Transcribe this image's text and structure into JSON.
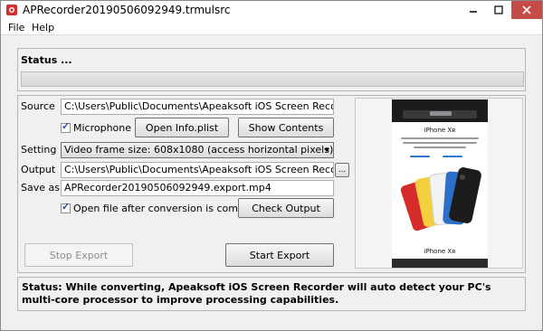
{
  "window": {
    "title": "APRecorder20190506092949.trmulsrc"
  },
  "menu": {
    "items": [
      {
        "label": "File"
      },
      {
        "label": "Help"
      }
    ]
  },
  "status_group": {
    "label": "Status ...",
    "progress": 0
  },
  "form": {
    "source_label": "Source",
    "source_value": "C:\\Users\\Public\\Documents\\Apeaksoft iOS Screen Recorder\\Projec",
    "microphone_label": "Microphone",
    "microphone_checked": true,
    "open_info_label": "Open Info.plist",
    "show_contents_label": "Show Contents",
    "setting_label": "Setting",
    "setting_value": "Video frame size: 608x1080 (access horizontal pixels)",
    "output_label": "Output",
    "output_value": "C:\\Users\\Public\\Documents\\Apeaksoft iOS Screen Recorder\\Projec",
    "browse_label": "...",
    "save_as_label": "Save as",
    "save_as_value": "APRecorder20190506092949.export.mp4",
    "open_after_label": "Open file after conversion is complete",
    "open_after_checked": true,
    "check_output_label": "Check Output",
    "stop_export_label": "Stop Export",
    "start_export_label": "Start Export"
  },
  "preview": {
    "heading_top": "iPhone Xʀ",
    "heading_bottom": "iPhone Xʀ"
  },
  "status_bottom": {
    "text": "Status: While converting, Apeaksoft iOS Screen Recorder will auto detect your PC's multi-core processor to improve processing capabilities."
  },
  "colors": {
    "close_button": "#c44b46",
    "window_bg": "#f0f0f0"
  }
}
